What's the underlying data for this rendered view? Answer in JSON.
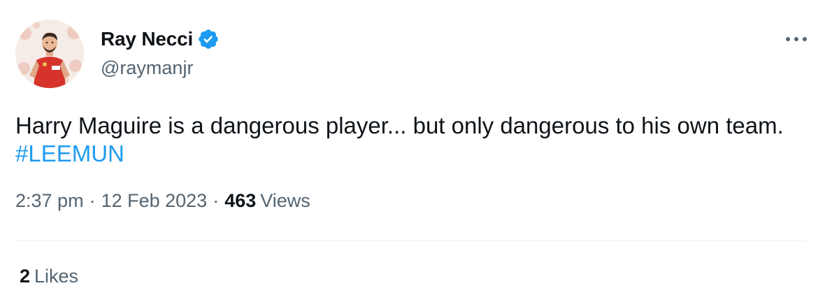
{
  "author": {
    "display_name": "Ray Necci",
    "handle": "@raymanjr",
    "verified": true,
    "verified_color": "#1d9bf0"
  },
  "tweet": {
    "text_main": "Harry Maguire is a dangerous player... but only dangerous to his own team. ",
    "hashtag": "#LEEMUN",
    "hashtag_color": "#1d9bf0"
  },
  "meta": {
    "time": "2:37 pm",
    "separator": "·",
    "date": "12 Feb 2023",
    "views_count": "463",
    "views_label": "Views"
  },
  "stats": {
    "likes_count": "2",
    "likes_label": "Likes"
  },
  "icons": {
    "more": "more-horizontal-icon",
    "verified": "verified-badge-icon"
  }
}
